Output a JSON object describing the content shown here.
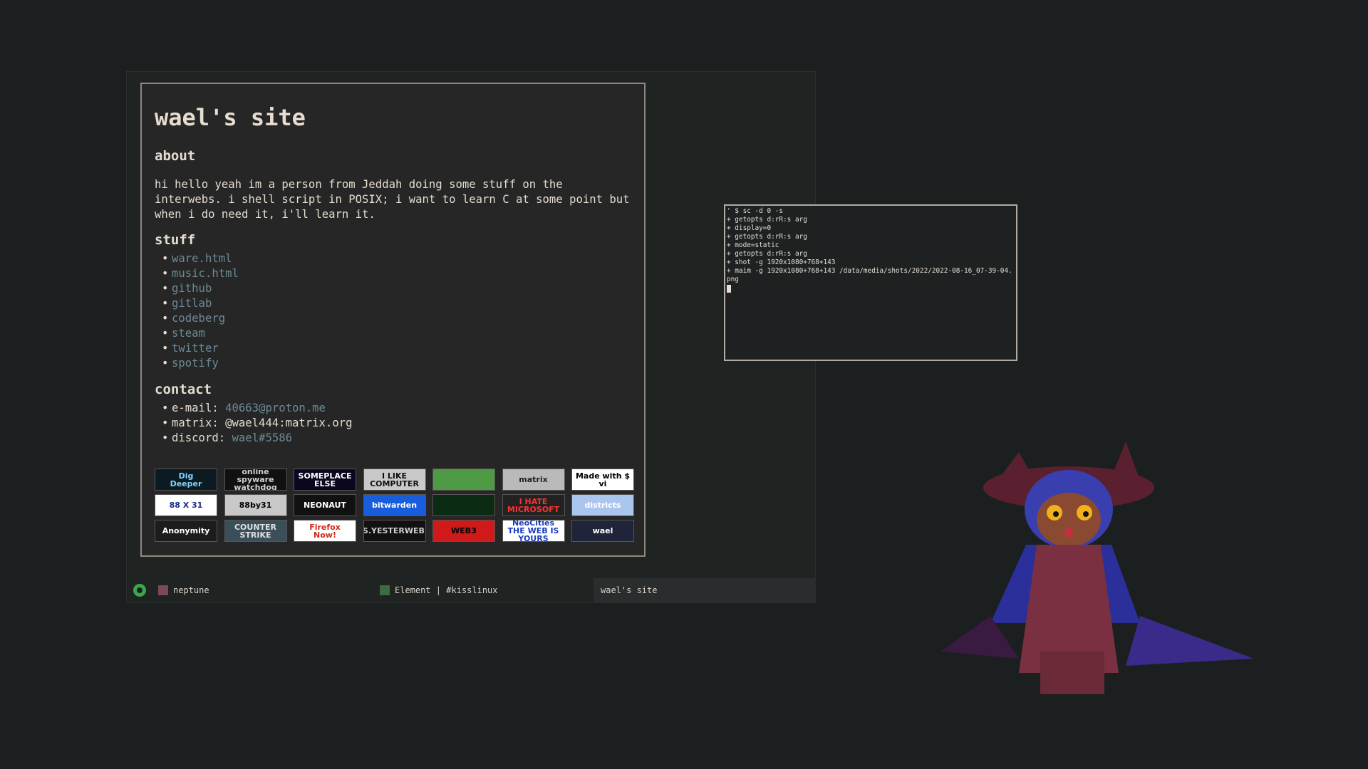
{
  "site": {
    "title": "wael's site",
    "about_heading": "about",
    "about_text": "hi hello yeah im a person from Jeddah doing some stuff on the interwebs. i shell script in POSIX; i want to learn C at some point but when i do need it, i'll learn it.",
    "stuff_heading": "stuff",
    "stuff_links": [
      "ware.html",
      "music.html",
      "github",
      "gitlab",
      "codeberg",
      "steam",
      "twitter",
      "spotify"
    ],
    "contact_heading": "contact",
    "contact": [
      {
        "label": "e-mail: ",
        "value": "40663@proton.me",
        "is_link": true
      },
      {
        "label": "matrix: ",
        "value": "@wael444:matrix.org",
        "is_link": false
      },
      {
        "label": "discord: ",
        "value": "wael#5586",
        "is_link": true
      }
    ],
    "badges": [
      {
        "text": "Dig\nDeeper",
        "bg": "#0c1a22",
        "fg": "#7fd3ff"
      },
      {
        "text": "online\nspyware\nwatchdog",
        "bg": "#111111",
        "fg": "#cfcfcf"
      },
      {
        "text": "SOMEPLACE\nELSE",
        "bg": "#0a0820",
        "fg": "#ffffff"
      },
      {
        "text": "I LIKE\nCOMPUTER",
        "bg": "#c9c9c9",
        "fg": "#111111"
      },
      {
        "text": "",
        "bg": "#4f9a45",
        "fg": "#ffffff"
      },
      {
        "text": "matrix",
        "bg": "#b9b9b9",
        "fg": "#222222"
      },
      {
        "text": "Made with  $ vi",
        "bg": "#ffffff",
        "fg": "#000000"
      },
      {
        "text": "88 X 31",
        "bg": "#ffffff",
        "fg": "#1a2a8a"
      },
      {
        "text": "88by31",
        "bg": "#c8c8c8",
        "fg": "#000000"
      },
      {
        "text": "NEONAUT",
        "bg": "#111111",
        "fg": "#ffffff"
      },
      {
        "text": "bitwarden",
        "bg": "#175ddc",
        "fg": "#ffffff"
      },
      {
        "text": "",
        "bg": "#0b2b12",
        "fg": "#39ff6a"
      },
      {
        "text": "I HATE\nMICROSOFT",
        "bg": "#222222",
        "fg": "#ff3030"
      },
      {
        "text": "districts",
        "bg": "#aac6ee",
        "fg": "#ffffff"
      },
      {
        "text": "Anonymity",
        "bg": "#1c1c1c",
        "fg": "#ffffff"
      },
      {
        "text": "COUNTER\nSTRIKE",
        "bg": "#3a4f5a",
        "fg": "#e0e0e0"
      },
      {
        "text": "Firefox\nNow!",
        "bg": "#ffffff",
        "fg": "#d02a1a"
      },
      {
        "text": "LINKS.YESTERWEB.ORG",
        "bg": "#111111",
        "fg": "#cfcfcf"
      },
      {
        "text": "WEB3",
        "bg": "#d01a1a",
        "fg": "#000000"
      },
      {
        "text": "NeoCities\nTHE WEB IS YOURS",
        "bg": "#ffffff",
        "fg": "#1a3ac0"
      },
      {
        "text": "wael",
        "bg": "#20243a",
        "fg": "#ffffff"
      }
    ]
  },
  "statusbar": {
    "workspace": "neptune",
    "window": "Element | #kisslinux",
    "focused": "wael's site"
  },
  "terminal": {
    "lines": [
      "' $ sc -d 0 -s",
      "+ getopts d:rR:s arg",
      "+ display=0",
      "+ getopts d:rR:s arg",
      "+ mode=static",
      "+ getopts d:rR:s arg",
      "+ shot -g 1920x1080+768+143",
      "+ maim -g 1920x1080+768+143 /data/media/shots/2022/2022-08-16_07-39-04.png"
    ]
  },
  "icons": {
    "tray": "audio-tray-icon",
    "mascot": "cat-character-icon"
  },
  "colors": {
    "link": "#6e8a97",
    "text": "#e6dccf",
    "background": "#1b1f1f"
  }
}
